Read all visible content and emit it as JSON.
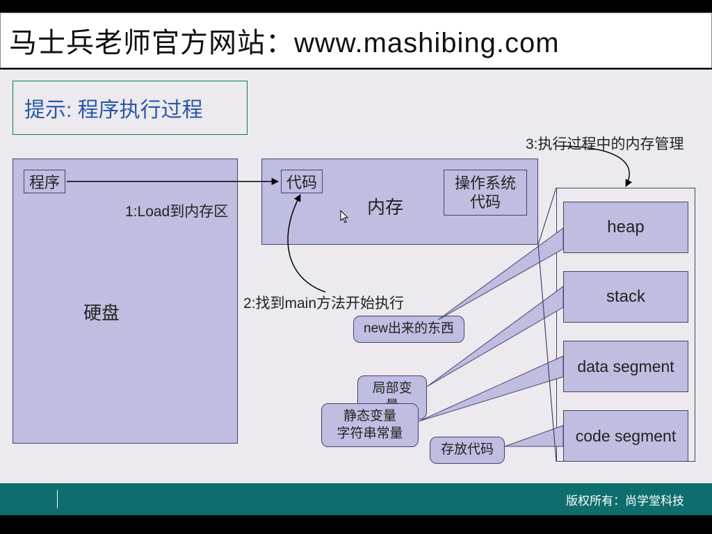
{
  "header": {
    "text": "马士兵老师官方网站：www.mashibing.com"
  },
  "title": "提示: 程序执行过程",
  "disk": {
    "program": "程序",
    "label": "硬盘"
  },
  "labels": {
    "load": "1:Load到内存区",
    "main": "2:找到main方法开始执行",
    "memMgmt": "3:执行过程中的内存管理"
  },
  "mem": {
    "code": "代码",
    "label": "内存",
    "os_line1": "操作系统",
    "os_line2": "代码"
  },
  "segments": {
    "heap": "heap",
    "stack": "stack",
    "data": "data segment",
    "code": "code segment"
  },
  "bubbles": {
    "new": "new出来的东西",
    "local": "局部变量",
    "static_line1": "静态变量",
    "static_line2": "字符串常量",
    "store": "存放代码"
  },
  "footer": {
    "copyright": "版权所有：尚学堂科技"
  }
}
